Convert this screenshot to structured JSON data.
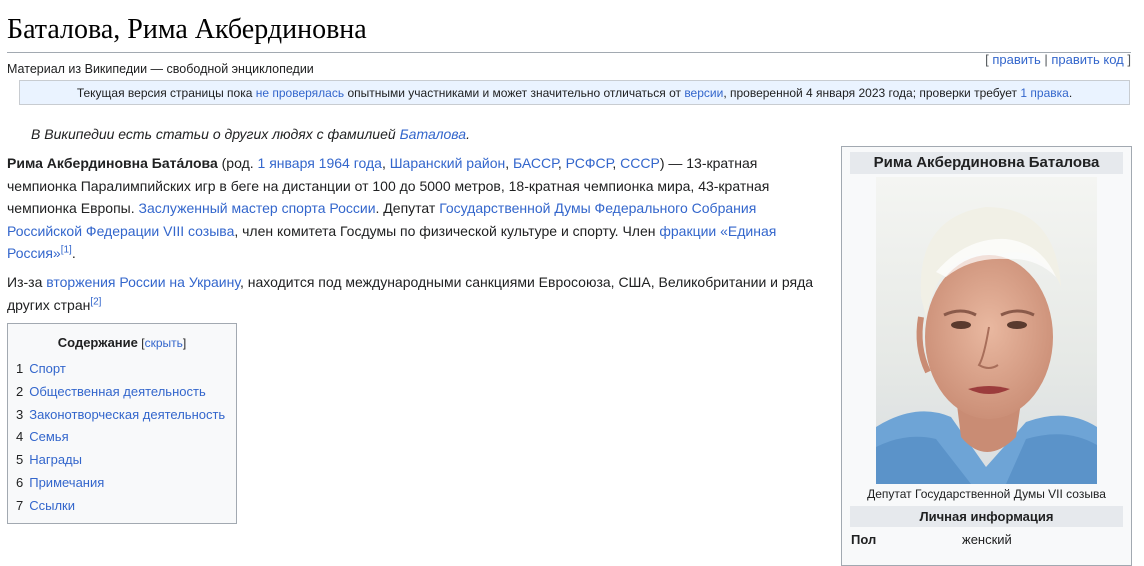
{
  "page": {
    "title": "Баталова, Рима Акбердиновна",
    "subtitle": "Материал из Википедии — свободной энциклопедии",
    "edit": {
      "open": "[ ",
      "edit": "править",
      "sep": " | ",
      "edit_code": "править код",
      "close": " ]"
    }
  },
  "notice": {
    "t1": "Текущая версия страницы пока ",
    "l1": "не проверялась",
    "t2": " опытными участниками и может значительно отличаться от ",
    "l2": "версии",
    "t3": ", проверенной 4 января 2023 года; проверки требует ",
    "l3": "1 правка",
    "t4": "."
  },
  "hatnote": {
    "text": "В Википедии есть статьи о других людях с фамилией ",
    "link": "Баталова",
    "end": "."
  },
  "intro": {
    "name": "Рима Акбердиновна Бата́лова",
    "born_open": " (род. ",
    "born_date": "1 января 1964 года",
    "comma1": ", ",
    "born_place": "Шаранский район",
    "comma2": ", ",
    "bassr": "БАССР",
    "comma3": ", ",
    "rsfsr": "РСФСР",
    "comma4": ", ",
    "ussr": "СССР",
    "t1": ") — 13-кратная чемпионка Паралимпийских игр в беге на дистанции от 100 до 5000 метров, 18-кратная чемпионка мира, 43-кратная чемпионка Европы. ",
    "l_master": "Заслуженный мастер спорта России",
    "t2": ". Депутат ",
    "l_duma": "Государственной Думы Федерального Собрания Российской Федерации VIII созыва",
    "t3": ", член комитета Госдумы по физической культуре и спорту. Член ",
    "l_faction": "фракции «Единая Россия»",
    "ref1": "[1]",
    "t4": "."
  },
  "sanctions": {
    "t1": "Из-за ",
    "l1": "вторжения России на Украину",
    "t2": ", находится под международными санкциями Евросоюза, США, Великобритании и ряда других стран",
    "ref2": "[2]"
  },
  "toc": {
    "heading": "Содержание",
    "toggle_open": " [",
    "toggle": "скрыть",
    "toggle_close": "]",
    "items": [
      {
        "num": "1",
        "label": "Спорт"
      },
      {
        "num": "2",
        "label": "Общественная деятельность"
      },
      {
        "num": "3",
        "label": "Законотворческая деятельность"
      },
      {
        "num": "4",
        "label": "Семья"
      },
      {
        "num": "5",
        "label": "Награды"
      },
      {
        "num": "6",
        "label": "Примечания"
      },
      {
        "num": "7",
        "label": "Ссылки"
      }
    ]
  },
  "infobox": {
    "title": "Рима Акбердиновна Баталова",
    "caption": "Депутат Государственной Думы VII созыва",
    "section": "Личная информация",
    "row_label": "Пол",
    "row_value": "женский"
  },
  "colors": {
    "link": "#3366cc",
    "notice_bg": "#eaf3ff",
    "photo_bg": "#6ea4d6"
  }
}
